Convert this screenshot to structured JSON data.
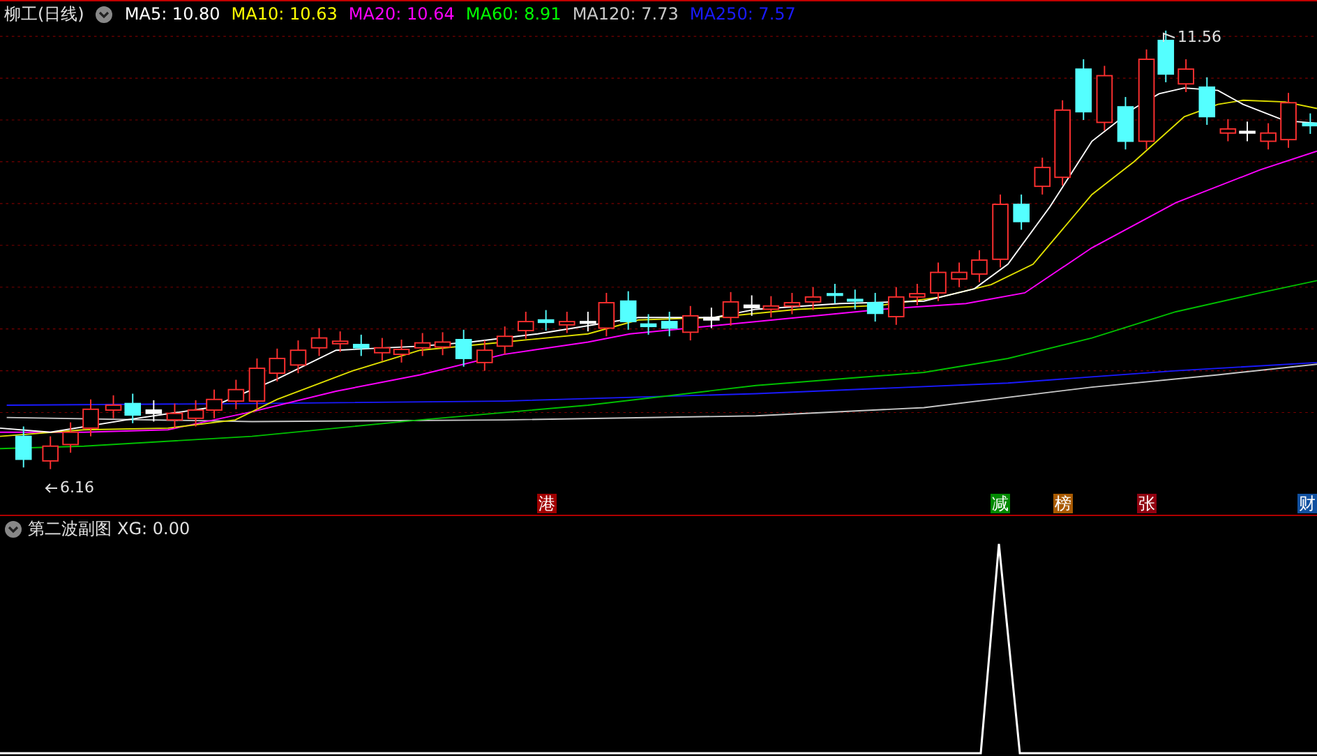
{
  "title": "柳工(日线)",
  "ma_legend": [
    {
      "label": "MA5: 10.80",
      "color": "#ffffff"
    },
    {
      "label": "MA10: 10.63",
      "color": "#ffff00"
    },
    {
      "label": "MA20: 10.64",
      "color": "#ff00ff"
    },
    {
      "label": "MA60: 8.91",
      "color": "#00ff00"
    },
    {
      "label": "MA120: 7.73",
      "color": "#c8c8c8"
    },
    {
      "label": "MA250: 7.57",
      "color": "#1a1aff"
    }
  ],
  "price_marks": [
    {
      "kind": "high",
      "text": "11.56"
    },
    {
      "kind": "low",
      "text": "6.16"
    }
  ],
  "event_tags": [
    {
      "label": "港",
      "color": "#a00000"
    },
    {
      "label": "减",
      "color": "#008a00"
    },
    {
      "label": "榜",
      "color": "#a85a00"
    },
    {
      "label": "张",
      "color": "#900010"
    },
    {
      "label": "财",
      "color": "#1050a0"
    }
  ],
  "sub_panel": {
    "title": "第二波副图",
    "reading": "XG: 0.00"
  }
}
